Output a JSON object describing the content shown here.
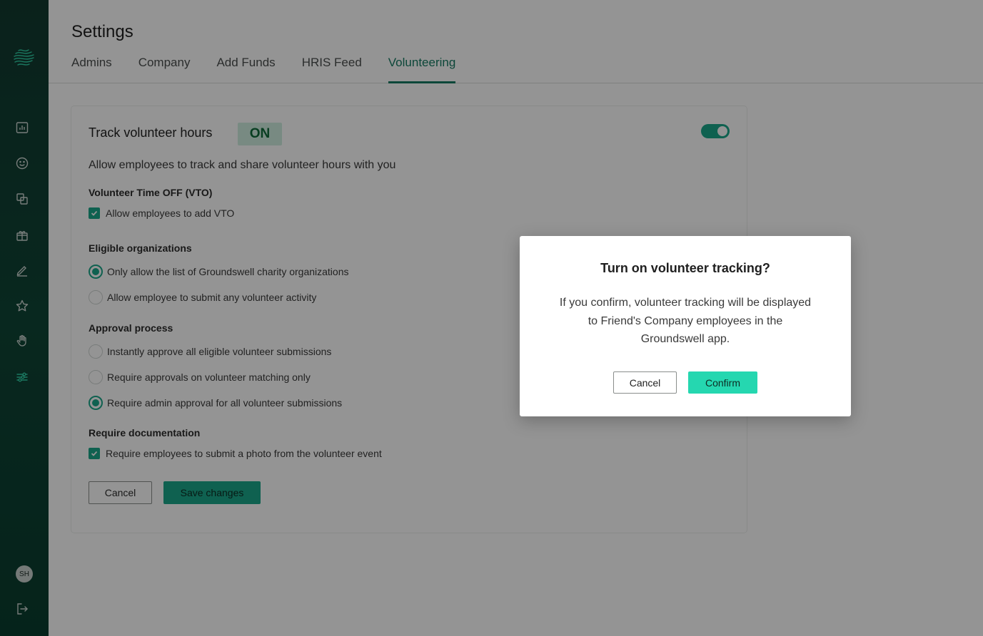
{
  "sidebar": {
    "logo_icon": "groundswell-wave-logo-icon",
    "nav_icons": [
      "bar-chart-icon",
      "smiley-icon",
      "copy-icon",
      "gift-icon",
      "pencil-icon",
      "star-icon",
      "hand-icon",
      "sliders-icon"
    ],
    "active_icon": "sliders-icon",
    "avatar_initials": "SH",
    "logout_icon": "logout-icon"
  },
  "header": {
    "title": "Settings",
    "tabs": [
      {
        "label": "Admins",
        "active": false
      },
      {
        "label": "Company",
        "active": false
      },
      {
        "label": "Add Funds",
        "active": false
      },
      {
        "label": "HRIS Feed",
        "active": false
      },
      {
        "label": "Volunteering",
        "active": true
      }
    ]
  },
  "card": {
    "title": "Track volunteer hours",
    "status_badge": "ON",
    "toggle_on": true,
    "description": "Allow employees to track and share volunteer hours with you",
    "vto": {
      "label": "Volunteer Time OFF (VTO)",
      "option": {
        "label": "Allow employees to add VTO",
        "checked": true
      }
    },
    "eligible": {
      "label": "Eligible organizations",
      "options": [
        {
          "label": "Only allow the list of Groundswell charity organizations",
          "checked": true
        },
        {
          "label": "Allow employee to submit any volunteer activity",
          "checked": false
        }
      ]
    },
    "approval": {
      "label": "Approval process",
      "options": [
        {
          "label": "Instantly approve all eligible volunteer submissions",
          "checked": false
        },
        {
          "label": "Require approvals on volunteer matching only",
          "checked": false
        },
        {
          "label": "Require admin approval for all volunteer submissions",
          "checked": true
        }
      ]
    },
    "documentation": {
      "label": "Require documentation",
      "option": {
        "label": "Require employees to submit a photo from the volunteer event",
        "checked": true
      }
    },
    "cancel_label": "Cancel",
    "save_label": "Save changes"
  },
  "modal": {
    "title": "Turn on volunteer tracking?",
    "body_lines": [
      "If you confirm, volunteer tracking will be displayed",
      "to Friend's Company employees in the",
      "Groundswell app."
    ],
    "cancel_label": "Cancel",
    "confirm_label": "Confirm"
  },
  "colors": {
    "sidebar_bg": "#0f4536",
    "accent": "#1aa78a",
    "confirm_button": "#25d7b0",
    "active_tab": "#167a63",
    "on_badge_bg": "#cfeee0",
    "on_badge_text": "#0f6b3a"
  }
}
